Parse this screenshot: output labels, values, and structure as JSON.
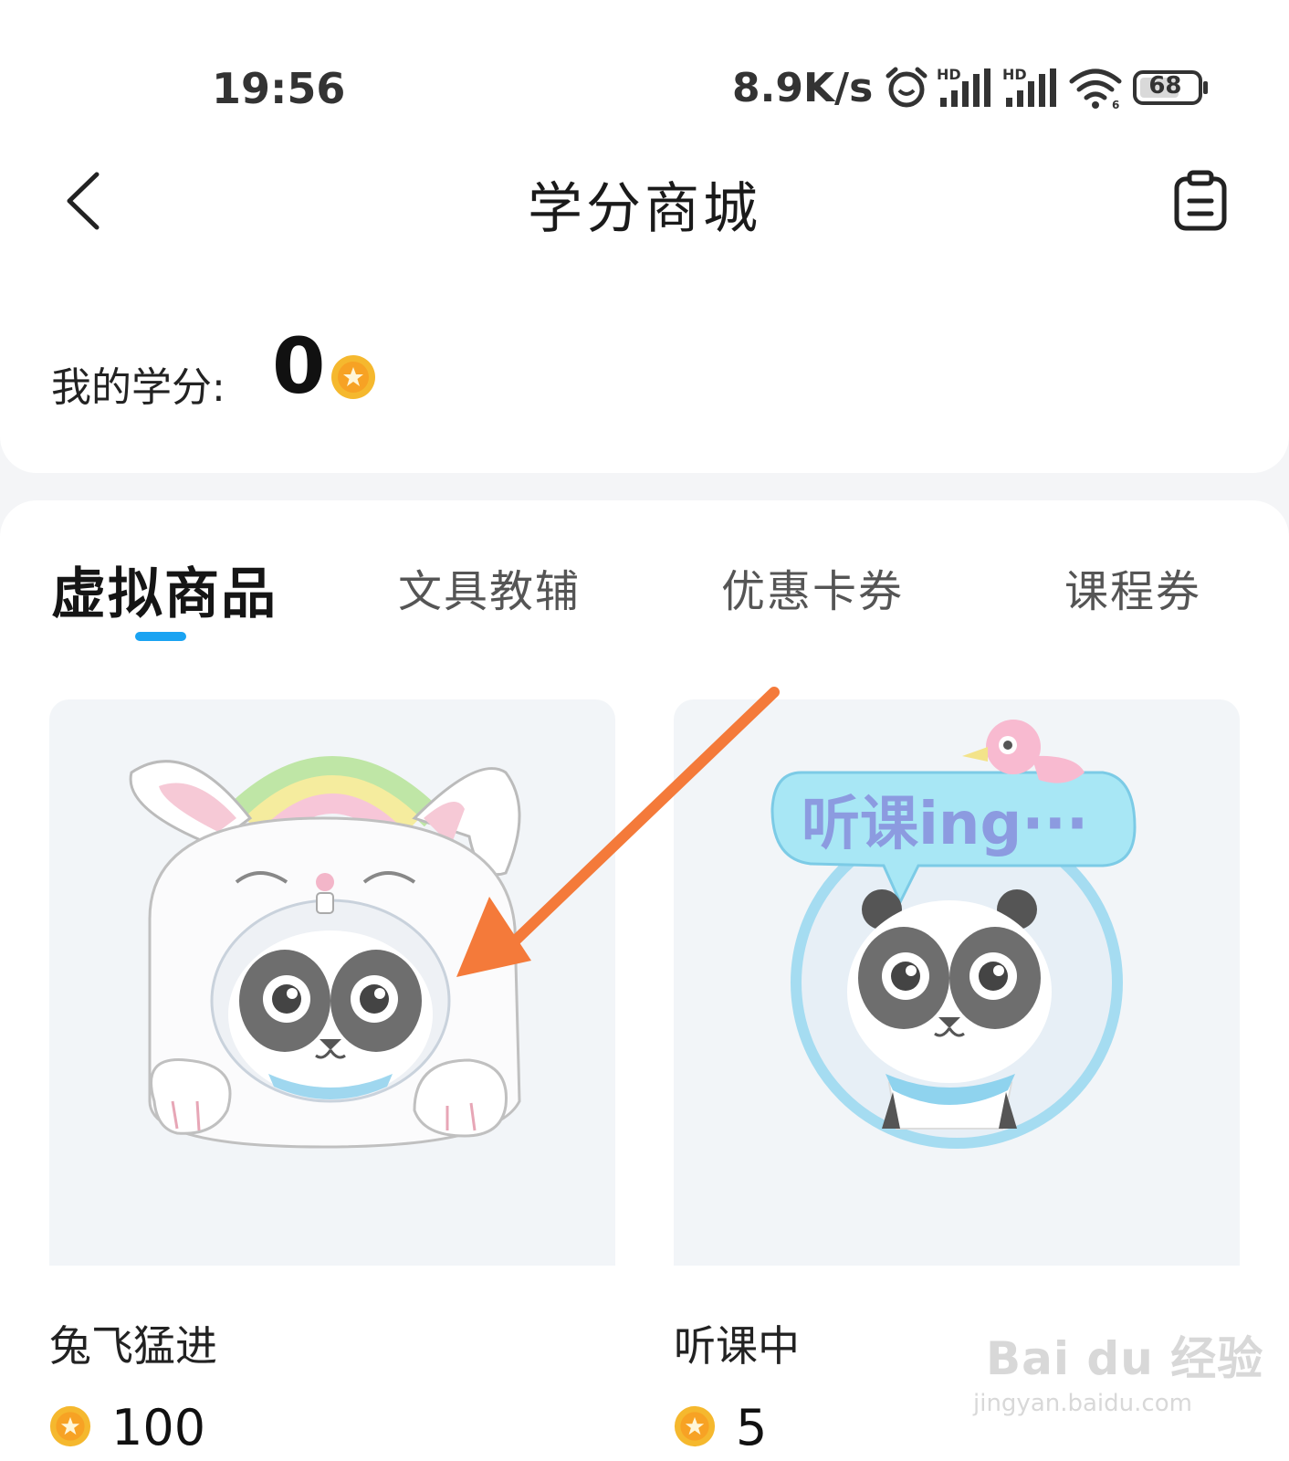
{
  "status_bar": {
    "time": "19:56",
    "net_speed": "8.9K/s",
    "battery": "68",
    "icons": [
      "alarm-icon",
      "hd-signal-icon",
      "hd-signal-icon",
      "wifi-icon",
      "battery-icon"
    ]
  },
  "nav": {
    "back_icon": "chevron-left-icon",
    "title": "学分商城",
    "orders_icon": "clipboard-icon"
  },
  "credits": {
    "label": "我的学分:",
    "value": "0",
    "coin_icon": "coin-icon"
  },
  "tabs": [
    {
      "label": "虚拟商品",
      "active": true
    },
    {
      "label": "文具教辅",
      "active": false
    },
    {
      "label": "优惠卡券",
      "active": false
    },
    {
      "label": "课程券",
      "active": false
    }
  ],
  "products": [
    {
      "name": "兔飞猛进",
      "price": "100",
      "image": "rabbit-panda-avatar-frame"
    },
    {
      "name": "听课中",
      "price": "5",
      "image": "listening-panda-avatar-frame",
      "image_text": "听课ing···"
    }
  ],
  "watermark": {
    "main": "Bai du 经验",
    "sub": "jingyan.baidu.com"
  },
  "colors": {
    "accent": "#1aa3f2",
    "coin": "#f5b82e",
    "arrow": "#f47a3a",
    "card_bg": "#f2f5f8",
    "page_bg": "#f4f5f7"
  }
}
